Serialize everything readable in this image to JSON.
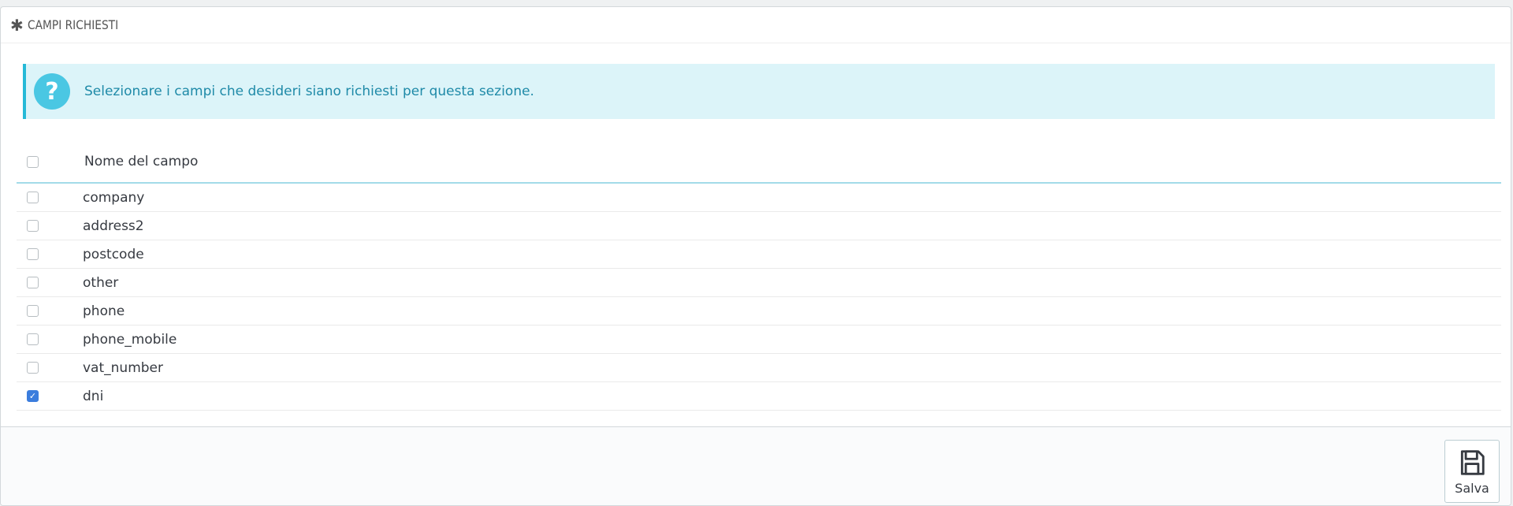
{
  "panel": {
    "title": "CAMPI RICHIESTI",
    "title_icon": "asterisk-icon"
  },
  "alert": {
    "icon": "question-icon",
    "icon_glyph": "?",
    "text": "Selezionare i campi che desideri siano richiesti per questa sezione."
  },
  "table": {
    "header": {
      "select_all_checked": false,
      "column_label": "Nome del campo"
    },
    "rows": [
      {
        "name": "company",
        "checked": false
      },
      {
        "name": "address2",
        "checked": false
      },
      {
        "name": "postcode",
        "checked": false
      },
      {
        "name": "other",
        "checked": false
      },
      {
        "name": "phone",
        "checked": false
      },
      {
        "name": "phone_mobile",
        "checked": false
      },
      {
        "name": "vat_number",
        "checked": false
      },
      {
        "name": "dni",
        "checked": true
      }
    ]
  },
  "footer": {
    "save_label": "Salva",
    "save_icon": "floppy-disk-icon"
  },
  "colors": {
    "accent": "#25b9d7",
    "alert_bg": "#dcf4f9",
    "alert_text": "#1f8aa8",
    "checkbox_checked": "#3b7ddd"
  }
}
